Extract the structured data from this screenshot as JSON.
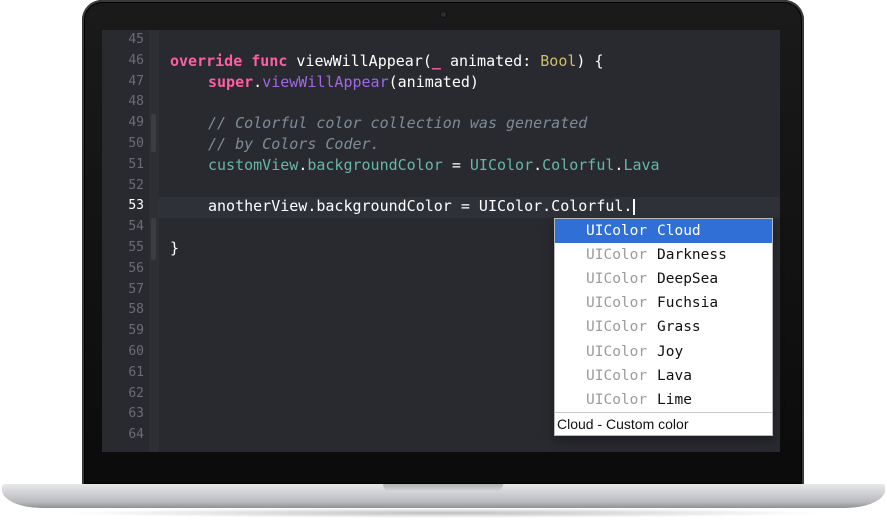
{
  "editor": {
    "line_numbers": [
      "45",
      "46",
      "47",
      "48",
      "49",
      "50",
      "51",
      "52",
      "53",
      "54",
      "55",
      "56",
      "57",
      "58",
      "59",
      "60",
      "61",
      "62",
      "63",
      "64"
    ],
    "current_line": "53",
    "code": {
      "l46": {
        "override": "override",
        "func": "func",
        "name": " viewWillAppear(",
        "underscore": "_",
        "param": " animated: ",
        "type": "Bool",
        "rest": ") {"
      },
      "l47": {
        "super": "super",
        "dot": ".",
        "call": "viewWillAppear",
        "args": "(animated)"
      },
      "l49": {
        "comment": "// Colorful color collection was generated"
      },
      "l50": {
        "comment": "// by Colors Coder."
      },
      "l51": {
        "obj": "customView",
        "dot1": ".",
        "prop": "backgroundColor",
        "eq": " = ",
        "cls": "UIColor",
        "dot2": ".",
        "ns": "Colorful",
        "dot3": ".",
        "val": "Lava"
      },
      "l53": {
        "text": "anotherView.backgroundColor = UIColor.Colorful."
      },
      "l55": {
        "text": "}"
      }
    }
  },
  "autocomplete": {
    "items": [
      {
        "type": "UIColor",
        "name": "Cloud",
        "selected": true
      },
      {
        "type": "UIColor",
        "name": "Darkness"
      },
      {
        "type": "UIColor",
        "name": "DeepSea"
      },
      {
        "type": "UIColor",
        "name": "Fuchsia"
      },
      {
        "type": "UIColor",
        "name": "Grass"
      },
      {
        "type": "UIColor",
        "name": "Joy"
      },
      {
        "type": "UIColor",
        "name": "Lava"
      },
      {
        "type": "UIColor",
        "name": "Lime"
      }
    ],
    "description": "Cloud - Custom color"
  },
  "colors": {
    "editor_bg": "#292a30",
    "keyword": "#fc5fa3",
    "function": "#a167e6",
    "type": "#d0bf69",
    "comment": "#7f8c98",
    "selection": "#2f6fd6"
  }
}
